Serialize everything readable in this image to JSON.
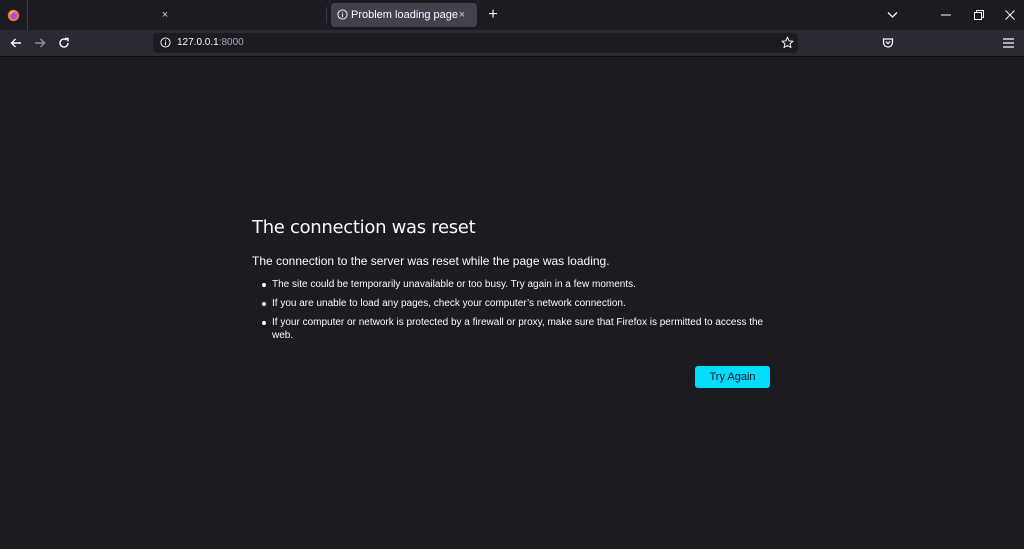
{
  "tabs": [
    {
      "title": "",
      "close": "×"
    },
    {
      "title": "Problem loading page",
      "close": "×"
    }
  ],
  "newtab_label": "+",
  "window_controls": {
    "list_tabs": "chevron-down-icon",
    "minimize": "—",
    "restore": "❐",
    "close": "✕"
  },
  "nav": {
    "url_host": "127.0.0.1",
    "url_port": ":8000"
  },
  "error": {
    "title": "The connection was reset",
    "subtitle": "The connection to the server was reset while the page was loading.",
    "items": [
      "The site could be temporarily unavailable or too busy. Try again in a few moments.",
      "If you are unable to load any pages, check your computer’s network connection.",
      "If your computer or network is protected by a firewall or proxy, make sure that Firefox is permitted to access the web."
    ],
    "button": "Try Again"
  },
  "colors": {
    "background": "#1c1b22",
    "toolbar": "#2b2a33",
    "active_tab": "#42414d",
    "button_accent": "#00ddff"
  }
}
